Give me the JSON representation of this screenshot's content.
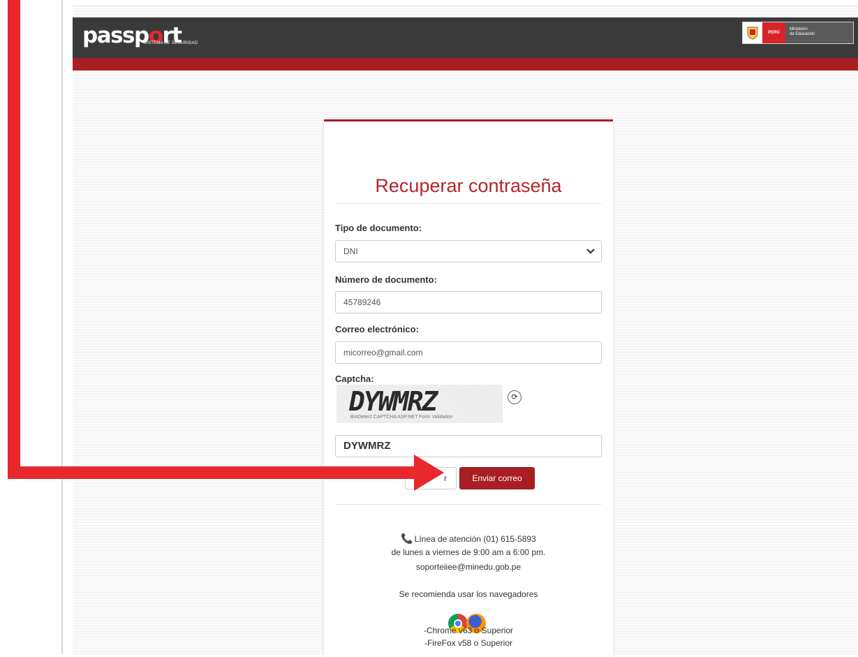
{
  "header": {
    "logo": {
      "word_before": "passp",
      "word_mark": "o",
      "word_after": "rt",
      "subtitle": "SISTEMA DE SEGURIDAD"
    },
    "gov_badge": {
      "country": "PERÚ",
      "ministry_line1": "Ministerio",
      "ministry_line2": "de Educación"
    }
  },
  "form": {
    "title": "Recuperar contraseña",
    "doc_type": {
      "label": "Tipo de documento:",
      "value": "DNI"
    },
    "doc_number": {
      "label": "Número de documento:",
      "value": "45789246"
    },
    "email": {
      "label": "Correo electrónico:",
      "value": "micorreo@gmail.com"
    },
    "captcha": {
      "label": "Captcha:",
      "image_text": "DYWMRZ",
      "image_caption": "BotDetect CAPTCHA ASP.NET Form Validation",
      "value": "DYWMRZ"
    },
    "buttons": {
      "cancel": "r",
      "send": "Enviar correo"
    }
  },
  "support": {
    "phone": "Línea de atención (01) 615-5893",
    "hours": "de lunes a viernes de 9:00 am a 6:00 pm.",
    "email": "soporteiiee@minedu.gob.pe",
    "browsers_note": "Se recomienda usar los navegadores",
    "chrome": "-Chrome v63 o Superior",
    "firefox": "-FireFox v58 o Superior"
  },
  "icons": {
    "select": "chevron-down-icon",
    "reload": "refresh-icon",
    "phone": "phone-icon",
    "annotation": "red-arrow-icon"
  },
  "colors": {
    "brand_red": "#a81e22",
    "header_dark": "#3a3a3a",
    "annotation_red": "#e8282d"
  }
}
